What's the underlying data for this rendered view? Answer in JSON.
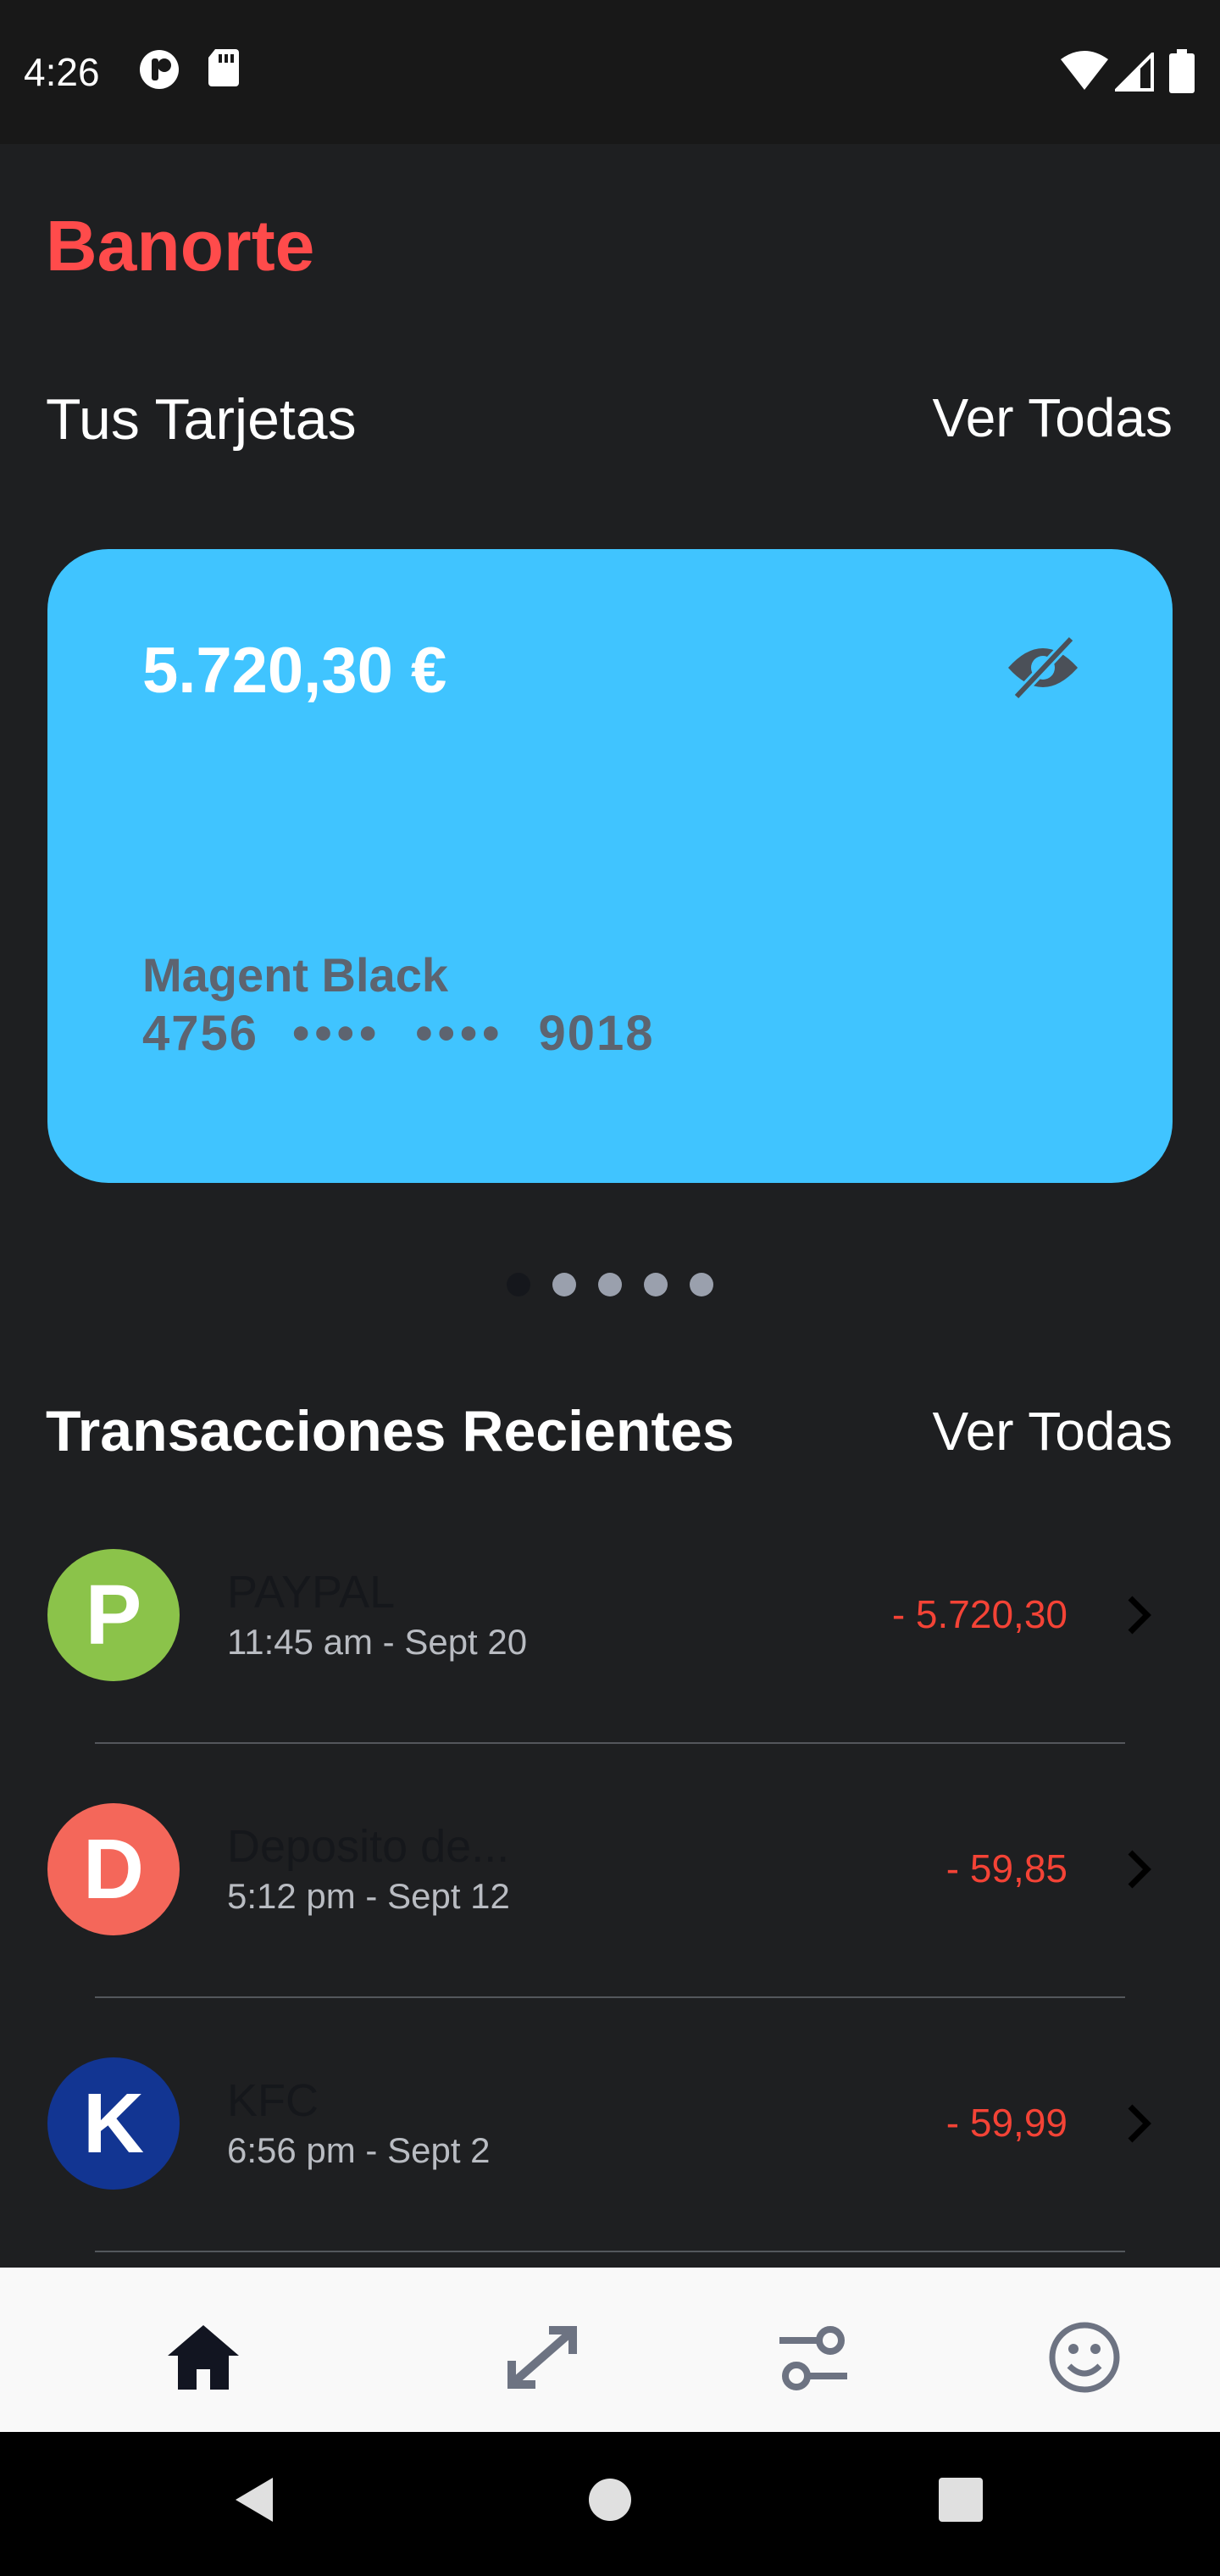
{
  "status_bar": {
    "time": "4:26",
    "icons": [
      "app-notification-icon",
      "sd-card-icon",
      "wifi-icon",
      "signal-icon",
      "battery-icon"
    ]
  },
  "app": {
    "brand": "Banorte",
    "brand_color": "#ff4b4b"
  },
  "cards_section": {
    "title": "Tus Tarjetas",
    "link": "Ver Todas"
  },
  "card": {
    "balance": "5.720,30 €",
    "name": "Magent Black",
    "number_start": "4756",
    "number_mask_1": "••••",
    "number_mask_2": "••••",
    "number_end": "9018",
    "color": "#40c4ff",
    "visibility_icon": "eye-off-icon"
  },
  "pager": {
    "count": 5,
    "active_index": 0
  },
  "transactions_section": {
    "title": "Transacciones Recientes",
    "link": "Ver Todas"
  },
  "transactions": [
    {
      "initial": "P",
      "name": "PAYPAL",
      "date": "11:45 am - Sept 20",
      "amount": "- 5.720,30",
      "color": "#8bc34a"
    },
    {
      "initial": "D",
      "name": "Deposito de...",
      "date": "5:12 pm - Sept 12",
      "amount": "- 59,85",
      "color": "#f4675a"
    },
    {
      "initial": "K",
      "name": "KFC",
      "date": "6:56 pm - Sept 2",
      "amount": "- 59,99",
      "color": "#123592"
    }
  ],
  "bottom_nav": [
    "home-icon",
    "transfer-icon",
    "settings-sliders-icon",
    "profile-smiley-icon"
  ],
  "system_nav": [
    "back-icon",
    "home-circle-icon",
    "recents-icon"
  ]
}
